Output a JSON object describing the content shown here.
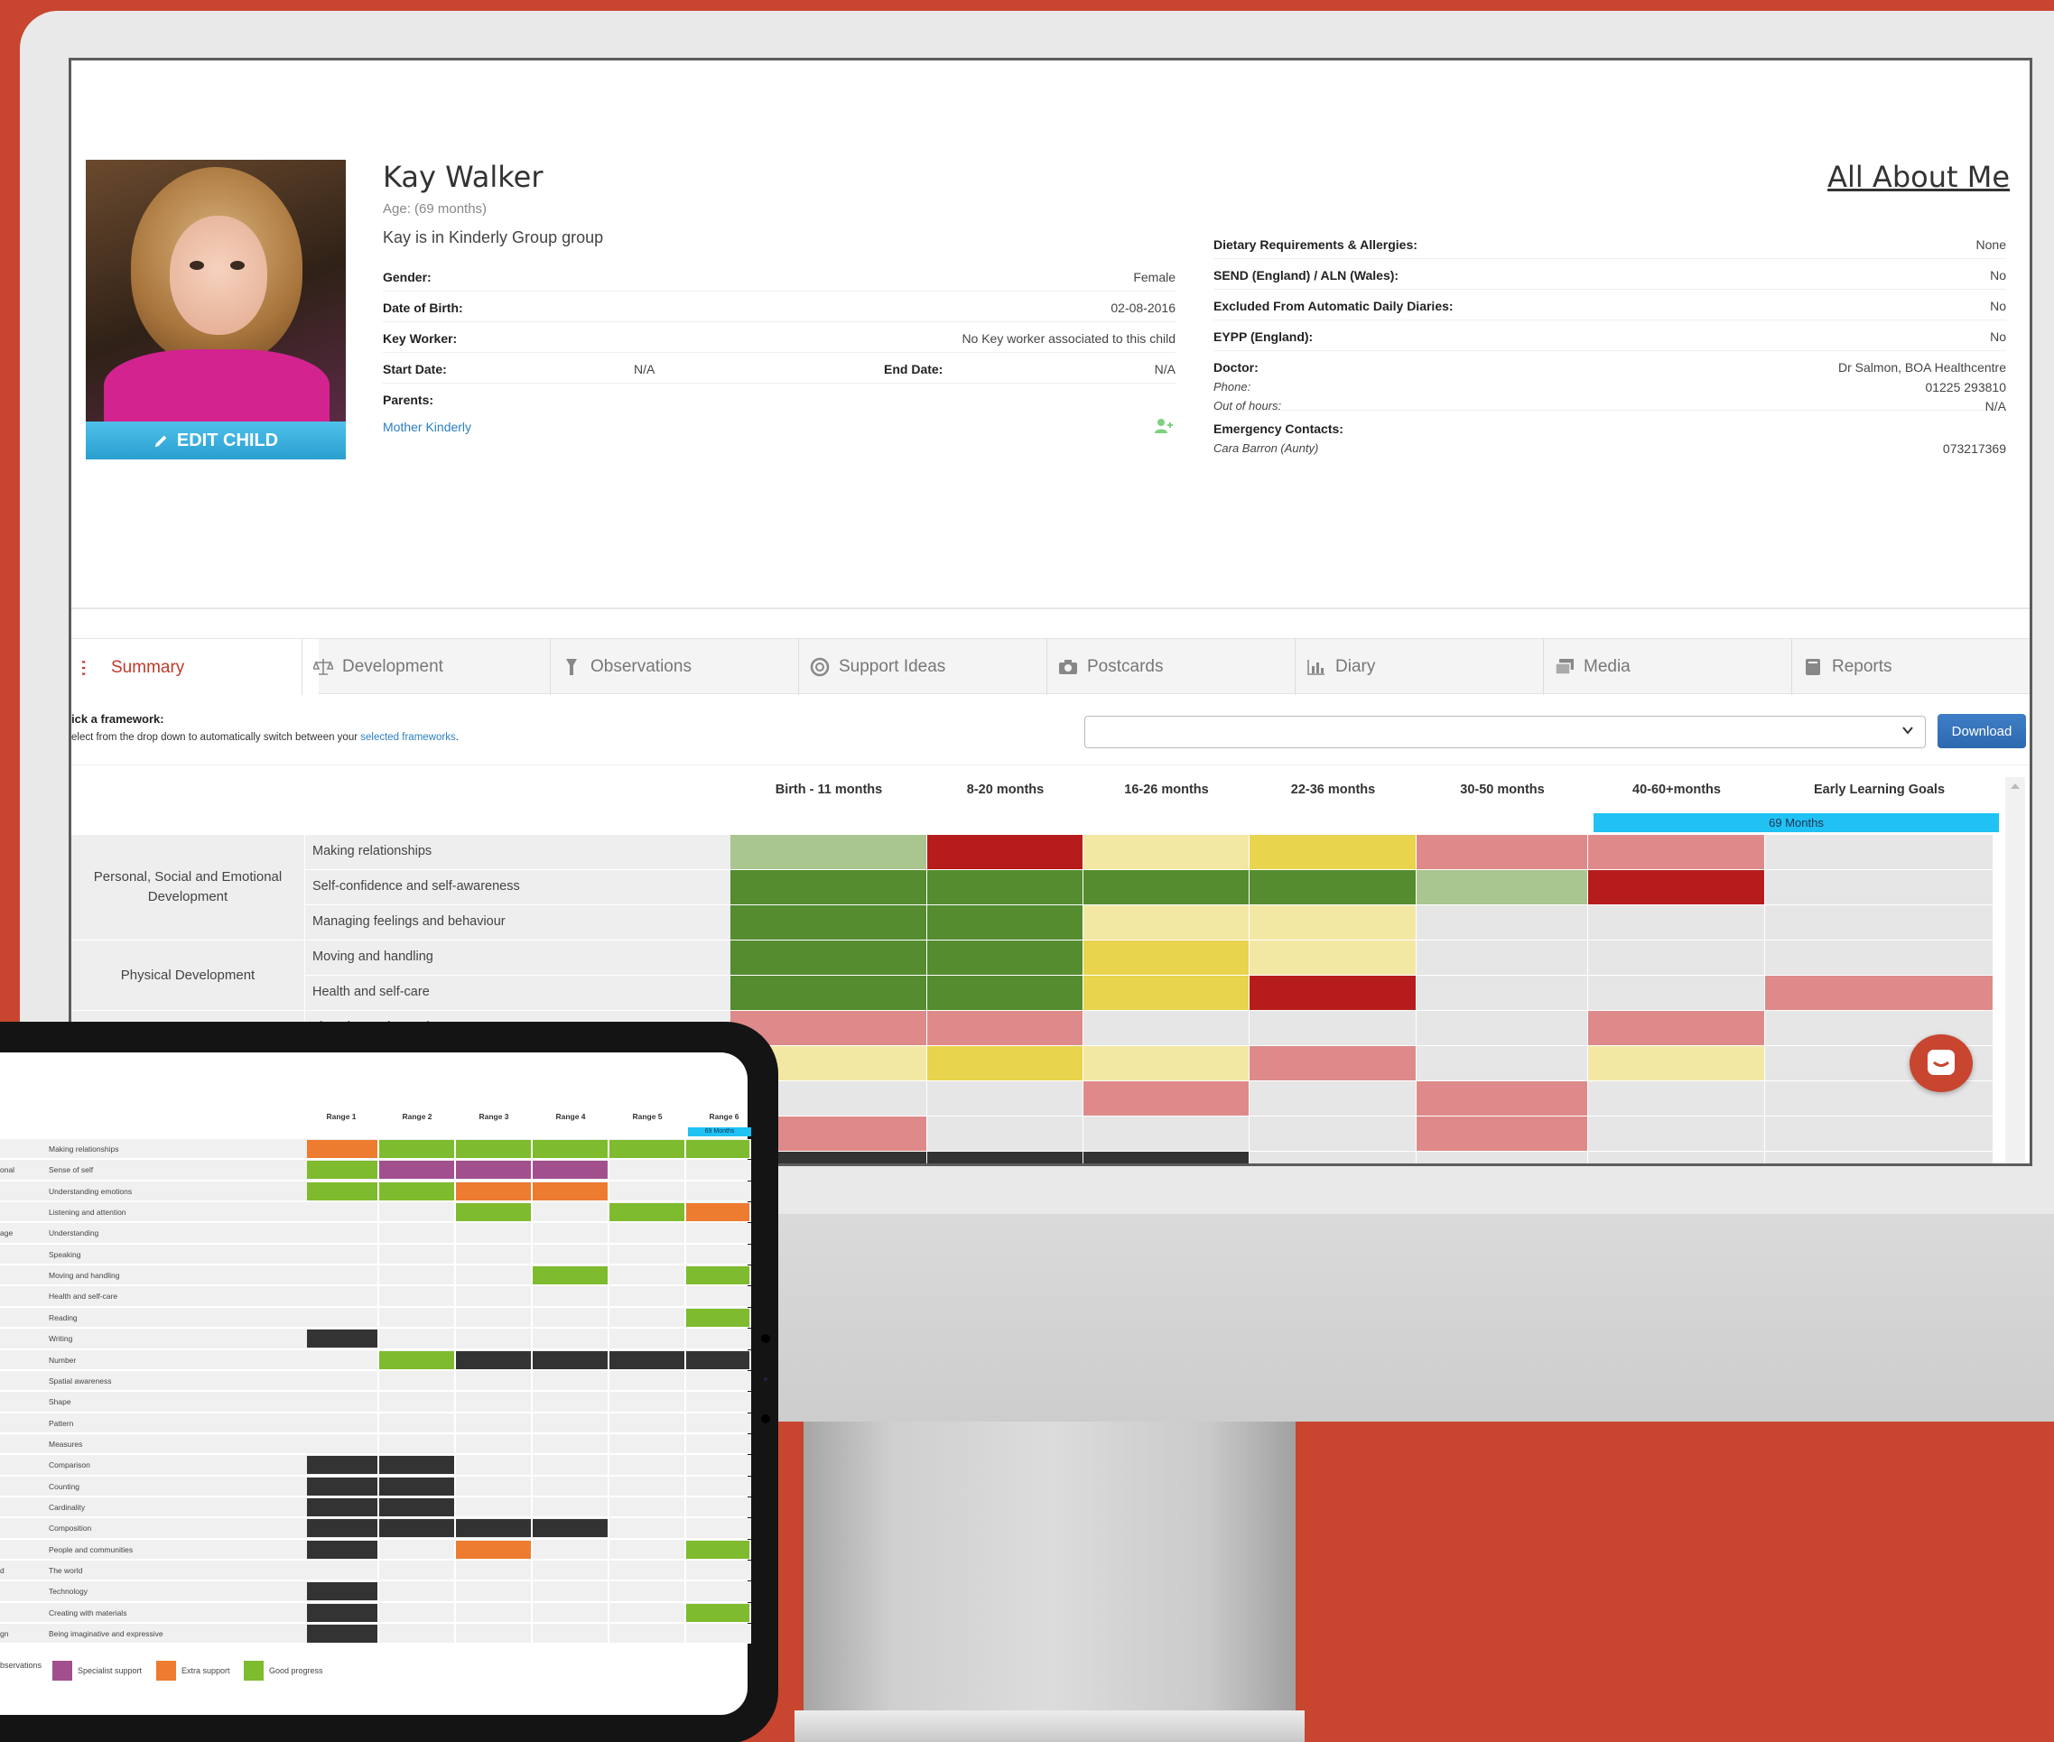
{
  "child": {
    "name": "Kay Walker",
    "age": "Age: (69 months)",
    "group": "Kay is in Kinderly Group group",
    "edit_label": "EDIT CHILD",
    "all_about_me": "All About Me"
  },
  "details_left": [
    {
      "label": "Gender:",
      "value": "Female"
    },
    {
      "label": "Date of Birth:",
      "value": "02-08-2016"
    },
    {
      "label": "Key Worker:",
      "value": "No Key worker associated to this child"
    },
    {
      "label": "Start Date:",
      "value": "N/A",
      "label2": "End Date:",
      "value2": "N/A"
    },
    {
      "label": "Parents:",
      "value": ""
    }
  ],
  "parent_link": "Mother Kinderly",
  "details_right": [
    {
      "label": "Dietary Requirements & Allergies:",
      "value": "None"
    },
    {
      "label": "SEND (England) / ALN (Wales):",
      "value": "No"
    },
    {
      "label": "Excluded From Automatic Daily Diaries:",
      "value": "No"
    },
    {
      "label": "EYPP (England):",
      "value": "No"
    }
  ],
  "doctor": {
    "label": "Doctor:",
    "value": "Dr Salmon, BOA Healthcentre",
    "phone_label": "Phone:",
    "phone": "01225 293810",
    "ooh_label": "Out of hours:",
    "ooh": "N/A"
  },
  "emergency": {
    "label": "Emergency Contacts:",
    "name": "Cara Barron (Aunty)",
    "phone": "073217369"
  },
  "tabs": [
    {
      "label": "Summary",
      "icon": "list-icon"
    },
    {
      "label": "Development",
      "icon": "scales-icon"
    },
    {
      "label": "Observations",
      "icon": "torch-icon"
    },
    {
      "label": "Support Ideas",
      "icon": "lifebuoy-icon"
    },
    {
      "label": "Postcards",
      "icon": "camera-icon"
    },
    {
      "label": "Diary",
      "icon": "bar-chart-icon"
    },
    {
      "label": "Media",
      "icon": "images-icon"
    },
    {
      "label": "Reports",
      "icon": "book-icon"
    }
  ],
  "framework": {
    "label": "ick a framework:",
    "help_prefix": "elect from the drop down to automatically switch between your ",
    "help_link": "selected frameworks",
    "help_suffix": ".",
    "selected": "",
    "download": "Download"
  },
  "colors": {
    "green": "#548c2f",
    "light_green": "#a9c590",
    "dark_red": "#b71c1c",
    "pink": "#de8a8a",
    "yellow": "#e8d44d",
    "light_yellow": "#f3e7a4",
    "empty": "#e6e6e6",
    "black": "#333333",
    "t_green": "#7ebb2e",
    "t_purple": "#a2508d",
    "t_orange": "#ed7b30",
    "t_black": "#333333",
    "accent_red": "#c8452f",
    "cyan": "#1fc2f3"
  },
  "grid": {
    "columns": [
      "Birth - 11 months",
      "8-20 months",
      "16-26 months",
      "22-36 months",
      "30-50 months",
      "40-60+months",
      "Early Learning Goals"
    ],
    "months_marker": "69 Months",
    "areas": [
      {
        "name": "Personal, Social and Emotional Development",
        "rows": 3
      },
      {
        "name": "Physical Development",
        "rows": 2
      },
      {
        "name": "",
        "rows": 5
      }
    ],
    "rows": [
      {
        "label": "Making relationships",
        "cells": [
          "light_green",
          "dark_red",
          "light_yellow",
          "yellow",
          "pink",
          "pink",
          "empty"
        ]
      },
      {
        "label": "Self-confidence and self-awareness",
        "cells": [
          "green",
          "green",
          "green",
          "green",
          "light_green",
          "dark_red",
          "empty"
        ]
      },
      {
        "label": "Managing feelings and behaviour",
        "cells": [
          "green",
          "green",
          "light_yellow",
          "light_yellow",
          "empty",
          "empty",
          "empty"
        ]
      },
      {
        "label": "Moving and handling",
        "cells": [
          "green",
          "green",
          "yellow",
          "light_yellow",
          "empty",
          "empty",
          "empty"
        ]
      },
      {
        "label": "Health and self-care",
        "cells": [
          "green",
          "green",
          "yellow",
          "dark_red",
          "empty",
          "empty",
          "pink"
        ]
      },
      {
        "label": "Listening and attention",
        "cells": [
          "pink",
          "pink",
          "empty",
          "empty",
          "empty",
          "pink",
          "empty"
        ]
      },
      {
        "label": "",
        "cells": [
          "light_yellow",
          "yellow",
          "light_yellow",
          "pink",
          "empty",
          "light_yellow",
          "empty"
        ]
      },
      {
        "label": "",
        "cells": [
          "empty",
          "empty",
          "pink",
          "empty",
          "pink",
          "empty",
          "empty"
        ]
      },
      {
        "label": "",
        "cells": [
          "pink",
          "empty",
          "empty",
          "empty",
          "pink",
          "empty",
          "empty"
        ]
      },
      {
        "label": "",
        "cells": [
          "black",
          "black",
          "black",
          "empty",
          "empty",
          "empty",
          "empty"
        ]
      }
    ]
  },
  "tablet": {
    "columns": [
      "Range 1",
      "Range 2",
      "Range 3",
      "Range 4",
      "Range 5",
      "Range 6"
    ],
    "months_marker": "69 Months",
    "rows": [
      {
        "area": "",
        "label": "Making relationships",
        "cells": [
          "t_orange",
          "t_green",
          "t_green",
          "t_green",
          "t_green",
          "t_green"
        ]
      },
      {
        "area": "onal",
        "label": "Sense of self",
        "cells": [
          "t_green",
          "t_purple",
          "t_purple",
          "t_purple",
          "",
          ""
        ]
      },
      {
        "area": "",
        "label": "Understanding emotions",
        "cells": [
          "t_green",
          "t_green",
          "t_orange",
          "t_orange",
          "",
          ""
        ]
      },
      {
        "area": "",
        "label": "Listening and attention",
        "cells": [
          "",
          "",
          "t_green",
          "",
          "t_green",
          "t_orange"
        ]
      },
      {
        "area": "age",
        "label": "Understanding",
        "cells": [
          "",
          "",
          "",
          "",
          "",
          ""
        ]
      },
      {
        "area": "",
        "label": "Speaking",
        "cells": [
          "",
          "",
          "",
          "",
          "",
          ""
        ]
      },
      {
        "area": "",
        "label": "Moving and handling",
        "cells": [
          "",
          "",
          "",
          "t_green",
          "",
          "t_green"
        ]
      },
      {
        "area": "",
        "label": "Health and self-care",
        "cells": [
          "",
          "",
          "",
          "",
          "",
          ""
        ]
      },
      {
        "area": "",
        "label": "Reading",
        "cells": [
          "",
          "",
          "",
          "",
          "",
          "t_green"
        ]
      },
      {
        "area": "",
        "label": "Writing",
        "cells": [
          "t_black",
          "",
          "",
          "",
          "",
          ""
        ]
      },
      {
        "area": "",
        "label": "Number",
        "cells": [
          "",
          "t_green",
          "t_black",
          "t_black",
          "t_black",
          "t_black"
        ]
      },
      {
        "area": "",
        "label": "Spatial awareness",
        "cells": [
          "",
          "",
          "",
          "",
          "",
          ""
        ]
      },
      {
        "area": "",
        "label": "Shape",
        "cells": [
          "",
          "",
          "",
          "",
          "",
          ""
        ]
      },
      {
        "area": "",
        "label": "Pattern",
        "cells": [
          "",
          "",
          "",
          "",
          "",
          ""
        ]
      },
      {
        "area": "",
        "label": "Measures",
        "cells": [
          "",
          "",
          "",
          "",
          "",
          ""
        ]
      },
      {
        "area": "",
        "label": "Comparison",
        "cells": [
          "t_black",
          "t_black",
          "",
          "",
          "",
          ""
        ]
      },
      {
        "area": "",
        "label": "Counting",
        "cells": [
          "t_black",
          "t_black",
          "",
          "",
          "",
          ""
        ]
      },
      {
        "area": "",
        "label": "Cardinality",
        "cells": [
          "t_black",
          "t_black",
          "",
          "",
          "",
          ""
        ]
      },
      {
        "area": "",
        "label": "Composition",
        "cells": [
          "t_black",
          "t_black",
          "t_black",
          "t_black",
          "",
          ""
        ]
      },
      {
        "area": "",
        "label": "People and communities",
        "cells": [
          "t_black",
          "",
          "t_orange",
          "",
          "",
          "t_green"
        ]
      },
      {
        "area": "d",
        "label": "The world",
        "cells": [
          "",
          "",
          "",
          "",
          "",
          ""
        ]
      },
      {
        "area": "",
        "label": "Technology",
        "cells": [
          "t_black",
          "",
          "",
          "",
          "",
          ""
        ]
      },
      {
        "area": "",
        "label": "Creating with materials",
        "cells": [
          "t_black",
          "",
          "",
          "",
          "",
          "t_green"
        ]
      },
      {
        "area": "gn",
        "label": "Being imaginative and expressive",
        "cells": [
          "t_black",
          "",
          "",
          "",
          "",
          ""
        ]
      }
    ],
    "legend": [
      {
        "label": "bservations",
        "color": ""
      },
      {
        "label": "Specialist support",
        "color": "t_purple"
      },
      {
        "label": "Extra support",
        "color": "t_orange"
      },
      {
        "label": "Good progress",
        "color": "t_green"
      }
    ]
  }
}
